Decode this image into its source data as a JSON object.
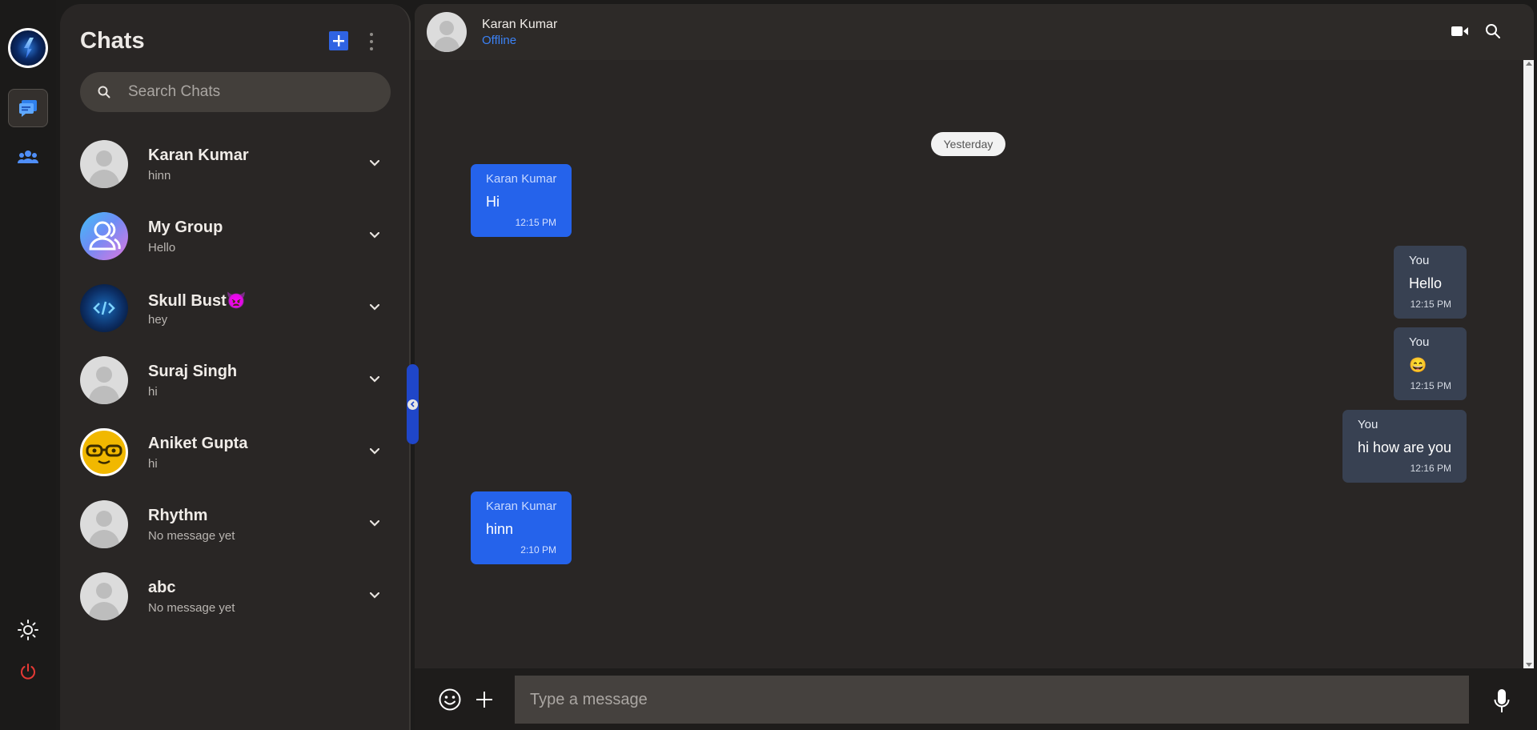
{
  "sidebar": {
    "title": "Chats",
    "search_placeholder": "Search Chats",
    "chats": [
      {
        "name": "Karan Kumar",
        "last_message": "hinn",
        "avatar": "default-avatar"
      },
      {
        "name": "My Group",
        "last_message": "Hello",
        "avatar": "group-avatar"
      },
      {
        "name": "Skull Bust👿",
        "last_message": "hey",
        "avatar": "code-avatar"
      },
      {
        "name": "Suraj Singh",
        "last_message": "hi",
        "avatar": "default-avatar"
      },
      {
        "name": "Aniket Gupta",
        "last_message": "hi",
        "avatar": "nerd-face-avatar"
      },
      {
        "name": "Rhythm",
        "last_message": "No message yet",
        "avatar": "default-avatar"
      },
      {
        "name": "abc",
        "last_message": "No message yet",
        "avatar": "default-avatar"
      }
    ]
  },
  "header": {
    "name": "Karan Kumar",
    "status": "Offline"
  },
  "conversation": {
    "day_label": "Yesterday",
    "messages": [
      {
        "sender": "Karan Kumar",
        "text": "Hi",
        "time": "12:15 PM",
        "direction": "incoming"
      },
      {
        "sender": "You",
        "text": "Hello",
        "time": "12:15 PM",
        "direction": "outgoing"
      },
      {
        "sender": "You",
        "text": "😄",
        "time": "12:15 PM",
        "direction": "outgoing"
      },
      {
        "sender": "You",
        "text": "hi how are you",
        "time": "12:16 PM",
        "direction": "outgoing"
      },
      {
        "sender": "Karan Kumar",
        "text": "hinn",
        "time": "2:10 PM",
        "direction": "incoming"
      }
    ]
  },
  "composer": {
    "placeholder": "Type a message"
  },
  "colors": {
    "accent": "#2563eb",
    "incoming_bubble": "#2563eb",
    "outgoing_bubble": "#384152",
    "status_offline": "#3b82f6",
    "power": "#e53935"
  },
  "icons": [
    "profile-avatar",
    "chat-icon",
    "groups-icon",
    "sun-icon",
    "power-icon",
    "add-icon",
    "more-vertical-icon",
    "search-icon",
    "chevron-down-icon",
    "video-call-icon",
    "emoji-icon",
    "plus-icon",
    "mic-icon"
  ]
}
